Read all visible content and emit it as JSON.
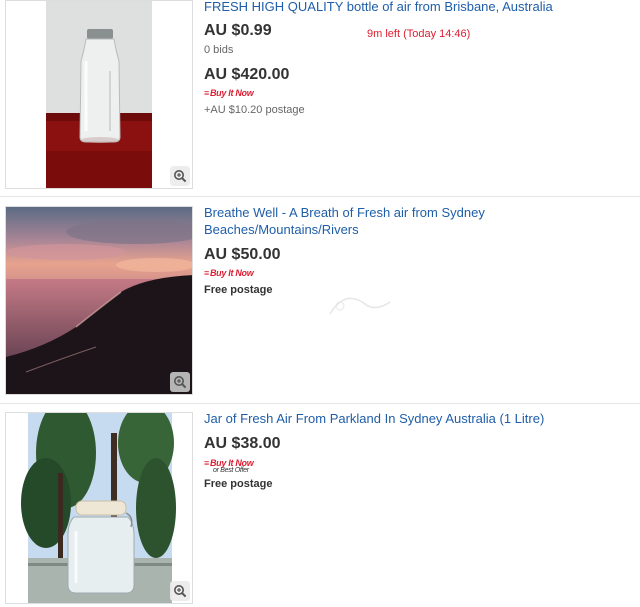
{
  "listings": [
    {
      "title": "FRESH HIGH QUALITY bottle of air from Brisbane, Australia",
      "current_bid": "AU $0.99",
      "bids": "0 bids",
      "time_left": "9m left (Today 14:46)",
      "buy_it_now_price": "AU $420.00",
      "buy_it_now_label": "Buy It Now",
      "postage": "+AU $10.20 postage",
      "image": "glass-bottle-on-red-table"
    },
    {
      "title": "Breathe Well - A Breath of Fresh air from Sydney Beaches/Mountains/Rivers",
      "price": "AU $50.00",
      "buy_it_now_label": "Buy It Now",
      "postage": "Free postage",
      "image": "sunset-over-coastal-cliffs"
    },
    {
      "title": "Jar of Fresh Air From Parkland In Sydney Australia (1 Litre)",
      "price": "AU $38.00",
      "buy_it_now_label": "Buy It Now",
      "best_offer_label": "or Best Offer",
      "postage": "Free postage",
      "image": "glass-jar-in-park"
    }
  ],
  "icons": {
    "zoom": "magnifier-plus-icon",
    "buy_it_now": "buy-it-now-logo"
  },
  "colors": {
    "link": "#1f5ea8",
    "time_left": "#dd1e31",
    "buy_it_now": "#dd1e31",
    "price": "#333333"
  }
}
